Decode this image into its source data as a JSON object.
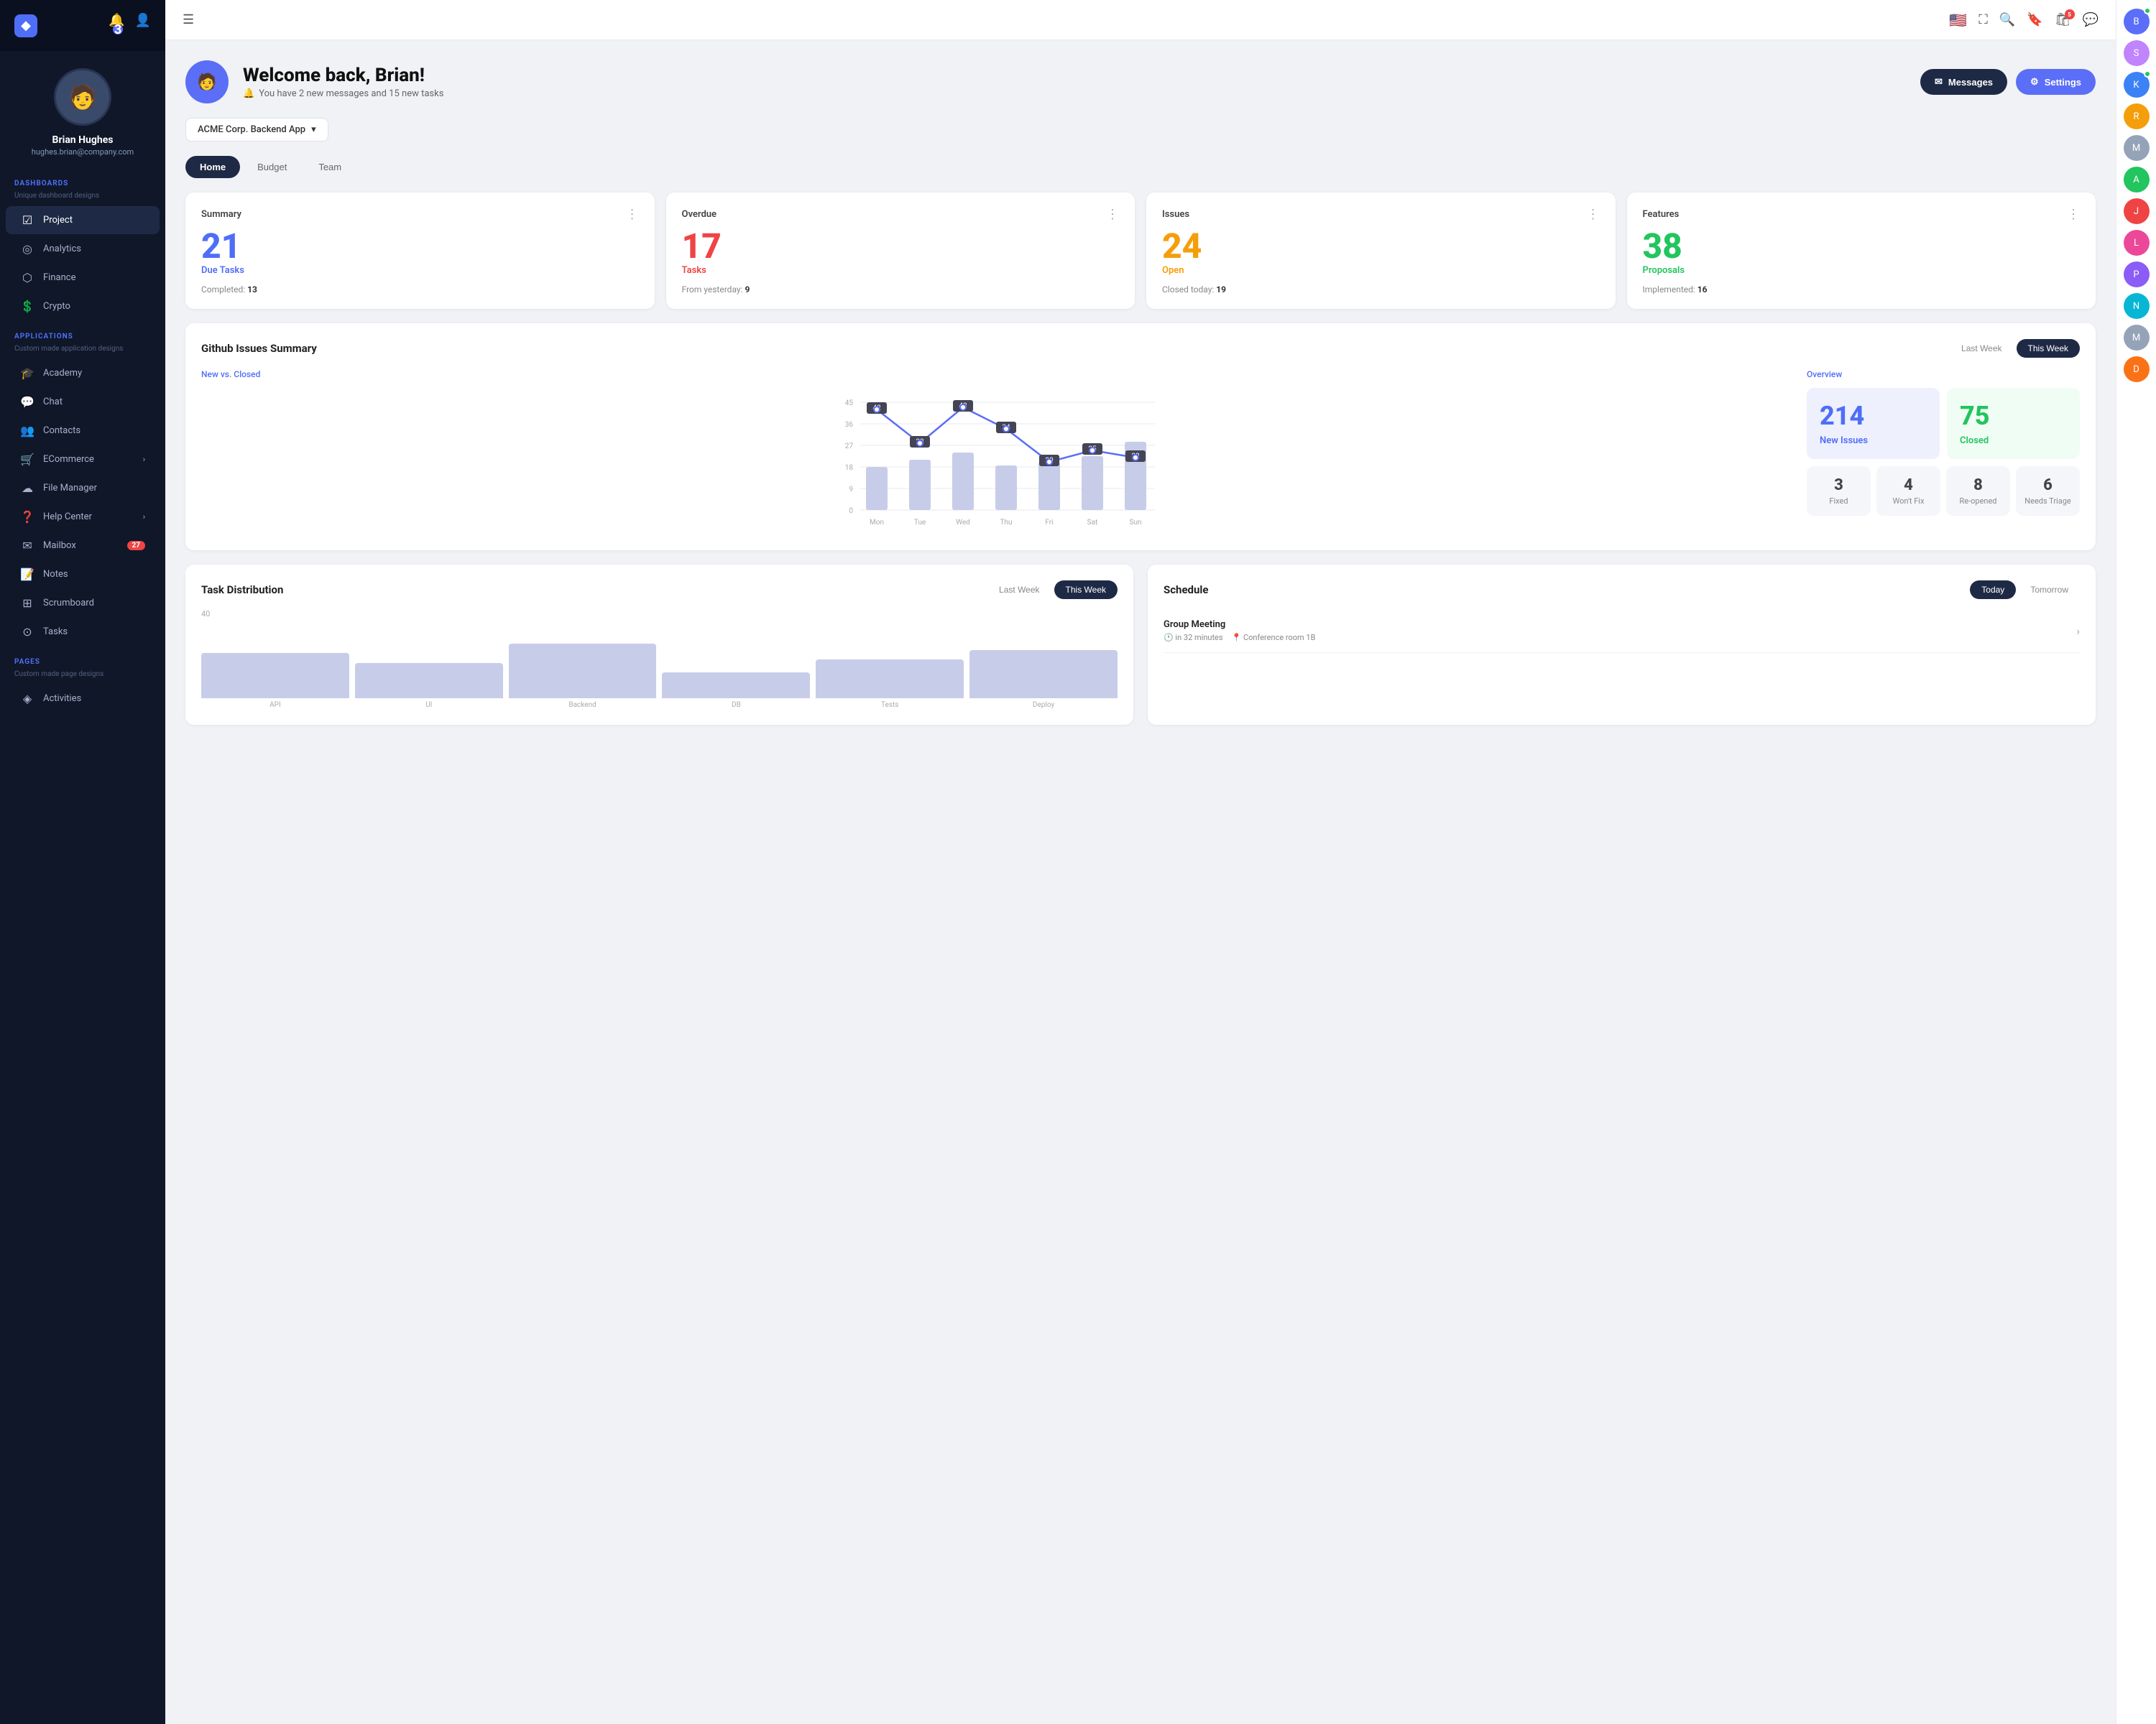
{
  "sidebar": {
    "logo": "◆",
    "notification_count": "3",
    "user": {
      "name": "Brian Hughes",
      "email": "hughes.brian@company.com"
    },
    "sections": [
      {
        "label": "DASHBOARDS",
        "sublabel": "Unique dashboard designs",
        "items": [
          {
            "id": "project",
            "icon": "☑",
            "label": "Project",
            "active": true
          },
          {
            "id": "analytics",
            "icon": "◎",
            "label": "Analytics"
          },
          {
            "id": "finance",
            "icon": "⬡",
            "label": "Finance"
          },
          {
            "id": "crypto",
            "icon": "💲",
            "label": "Crypto"
          }
        ]
      },
      {
        "label": "APPLICATIONS",
        "sublabel": "Custom made application designs",
        "items": [
          {
            "id": "academy",
            "icon": "🎓",
            "label": "Academy"
          },
          {
            "id": "chat",
            "icon": "💬",
            "label": "Chat"
          },
          {
            "id": "contacts",
            "icon": "👥",
            "label": "Contacts"
          },
          {
            "id": "ecommerce",
            "icon": "🛒",
            "label": "ECommerce",
            "hasChevron": true
          },
          {
            "id": "filemanager",
            "icon": "☁",
            "label": "File Manager"
          },
          {
            "id": "helpcenter",
            "icon": "❓",
            "label": "Help Center",
            "hasChevron": true
          },
          {
            "id": "mailbox",
            "icon": "✉",
            "label": "Mailbox",
            "badge": "27"
          },
          {
            "id": "notes",
            "icon": "📝",
            "label": "Notes"
          },
          {
            "id": "scrumboard",
            "icon": "⊞",
            "label": "Scrumboard"
          },
          {
            "id": "tasks",
            "icon": "⊙",
            "label": "Tasks"
          }
        ]
      },
      {
        "label": "PAGES",
        "sublabel": "Custom made page designs",
        "items": [
          {
            "id": "activities",
            "icon": "◈",
            "label": "Activities"
          }
        ]
      }
    ]
  },
  "topnav": {
    "menu_icon": "☰",
    "search_icon": "🔍",
    "bookmark_icon": "🔖",
    "messages_icon": "💬",
    "messages_badge": "5",
    "flag": "🇺🇸"
  },
  "right_panel": {
    "avatars": [
      {
        "initial": "B",
        "bg": "#5b6ef7",
        "has_badge": true
      },
      {
        "initial": "S",
        "bg": "#c084fc",
        "has_badge": false
      },
      {
        "initial": "K",
        "bg": "#3b82f6",
        "has_badge": true
      },
      {
        "initial": "R",
        "bg": "#f59e0b",
        "has_badge": false
      },
      {
        "initial": "M",
        "bg": "#94a3b8",
        "has_badge": false
      },
      {
        "initial": "A",
        "bg": "#22c55e",
        "has_badge": false
      },
      {
        "initial": "J",
        "bg": "#ef4444",
        "has_badge": false
      },
      {
        "initial": "L",
        "bg": "#ec4899",
        "has_badge": false
      },
      {
        "initial": "P",
        "bg": "#8b5cf6",
        "has_badge": false
      },
      {
        "initial": "N",
        "bg": "#06b6d4",
        "has_badge": false
      },
      {
        "initial": "M",
        "bg": "#94a3b8",
        "has_badge": false
      },
      {
        "initial": "D",
        "bg": "#f97316",
        "has_badge": false
      }
    ]
  },
  "welcome": {
    "greeting": "Welcome back, Brian!",
    "subtitle": "You have 2 new messages and 15 new tasks",
    "bell_icon": "🔔",
    "messages_btn": "Messages",
    "messages_icon": "✉",
    "settings_btn": "Settings",
    "settings_icon": "⚙"
  },
  "project_selector": {
    "label": "ACME Corp. Backend App",
    "chevron": "▾"
  },
  "tabs": [
    {
      "id": "home",
      "label": "Home",
      "active": true
    },
    {
      "id": "budget",
      "label": "Budget",
      "active": false
    },
    {
      "id": "team",
      "label": "Team",
      "active": false
    }
  ],
  "stats": [
    {
      "title": "Summary",
      "number": "21",
      "number_color": "#4f6ef7",
      "label": "Due Tasks",
      "label_color": "#4f6ef7",
      "footer_text": "Completed:",
      "footer_value": "13"
    },
    {
      "title": "Overdue",
      "number": "17",
      "number_color": "#ef4444",
      "label": "Tasks",
      "label_color": "#ef4444",
      "footer_text": "From yesterday:",
      "footer_value": "9"
    },
    {
      "title": "Issues",
      "number": "24",
      "number_color": "#f59e0b",
      "label": "Open",
      "label_color": "#f59e0b",
      "footer_text": "Closed today:",
      "footer_value": "19"
    },
    {
      "title": "Features",
      "number": "38",
      "number_color": "#22c55e",
      "label": "Proposals",
      "label_color": "#22c55e",
      "footer_text": "Implemented:",
      "footer_value": "16"
    }
  ],
  "github_issues": {
    "title": "Github Issues Summary",
    "last_week": "Last Week",
    "this_week": "This Week",
    "chart": {
      "subtitle": "New vs. Closed",
      "y_labels": [
        "45",
        "36",
        "27",
        "18",
        "9",
        "0"
      ],
      "x_labels": [
        "Mon",
        "Tue",
        "Wed",
        "Thu",
        "Fri",
        "Sat",
        "Sun"
      ],
      "line_points": [
        {
          "day": "Mon",
          "val": 42,
          "bar": 30
        },
        {
          "day": "Tue",
          "val": 28,
          "bar": 35
        },
        {
          "day": "Wed",
          "val": 43,
          "bar": 38
        },
        {
          "day": "Thu",
          "val": 34,
          "bar": 28
        },
        {
          "day": "Fri",
          "val": 20,
          "bar": 25
        },
        {
          "day": "Sat",
          "val": 25,
          "bar": 32
        },
        {
          "day": "Sun",
          "val": 22,
          "bar": 40
        }
      ]
    },
    "overview": {
      "subtitle": "Overview",
      "new_issues_number": "214",
      "new_issues_label": "New Issues",
      "new_issues_color": "#4f6ef7",
      "closed_number": "75",
      "closed_label": "Closed",
      "closed_color": "#22c55e",
      "stats": [
        {
          "number": "3",
          "label": "Fixed"
        },
        {
          "number": "4",
          "label": "Won't Fix"
        },
        {
          "number": "8",
          "label": "Re-opened"
        },
        {
          "number": "6",
          "label": "Needs Triage"
        }
      ]
    }
  },
  "task_distribution": {
    "title": "Task Distribution",
    "last_week": "Last Week",
    "this_week": "This Week",
    "bars": [
      {
        "label": "API",
        "value": 70
      },
      {
        "label": "UI",
        "value": 55
      },
      {
        "label": "Backend",
        "value": 85
      },
      {
        "label": "DB",
        "value": 40
      },
      {
        "label": "Tests",
        "value": 60
      },
      {
        "label": "Deploy",
        "value": 75
      }
    ],
    "max_label": "40"
  },
  "schedule": {
    "title": "Schedule",
    "today_btn": "Today",
    "tomorrow_btn": "Tomorrow",
    "items": [
      {
        "title": "Group Meeting",
        "time": "in 32 minutes",
        "location": "Conference room 1B"
      }
    ]
  }
}
